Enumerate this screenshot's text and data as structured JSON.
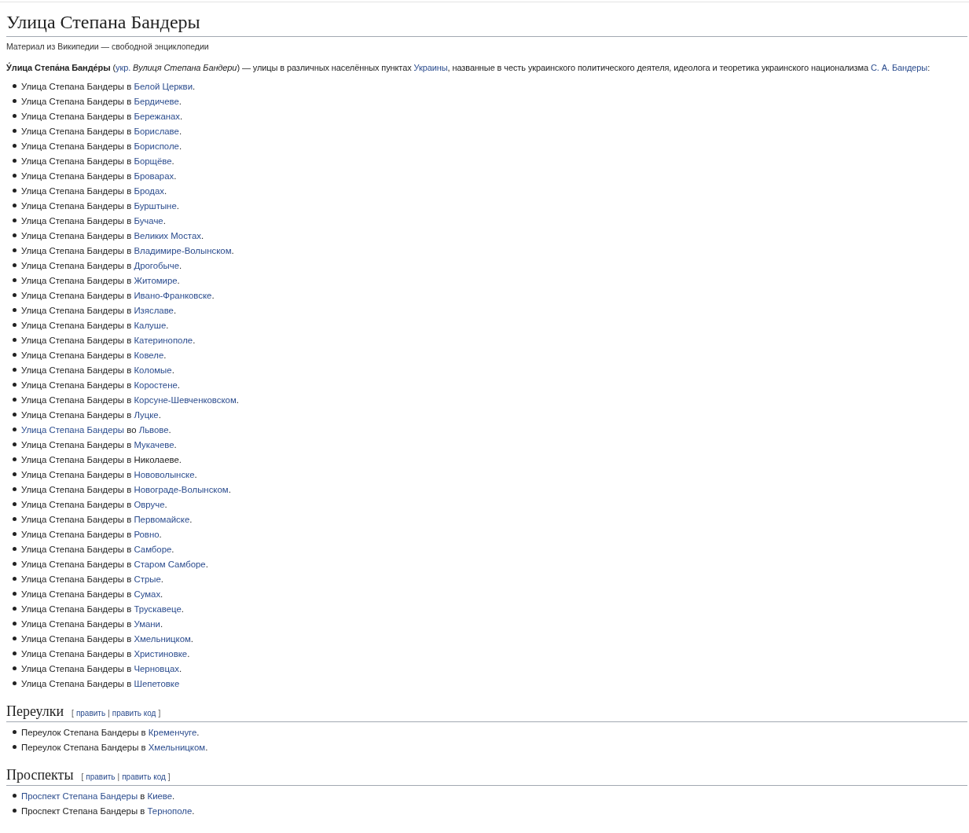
{
  "title": "Улица Степана Бандеры",
  "subtitle": "Материал из Википедии — свободной энциклопедии",
  "intro": [
    {
      "kind": "bold",
      "text": "У́лица Степа́на Банде́ры"
    },
    {
      "kind": "text",
      "text": " ("
    },
    {
      "kind": "link",
      "text": "укр."
    },
    {
      "kind": "italic",
      "text": " Вулиця Степана Бандери"
    },
    {
      "kind": "text",
      "text": ") — улицы в различных населённых пунктах "
    },
    {
      "kind": "link",
      "text": "Украины"
    },
    {
      "kind": "text",
      "text": ", названные в честь украинского политического деятеля, идеолога и теоретика украинского национализма "
    },
    {
      "kind": "link",
      "text": "С. А. Бандеры"
    },
    {
      "kind": "text",
      "text": ":"
    }
  ],
  "items": [
    {
      "parts": [
        {
          "kind": "text",
          "text": "Улица Степана Бандеры в "
        },
        {
          "kind": "link",
          "text": "Белой Церкви"
        },
        {
          "kind": "text",
          "text": "."
        }
      ]
    },
    {
      "parts": [
        {
          "kind": "text",
          "text": "Улица Степана Бандеры в "
        },
        {
          "kind": "link",
          "text": "Бердичеве"
        },
        {
          "kind": "text",
          "text": "."
        }
      ]
    },
    {
      "parts": [
        {
          "kind": "text",
          "text": "Улица Степана Бандеры в "
        },
        {
          "kind": "link",
          "text": "Бережанах"
        },
        {
          "kind": "text",
          "text": "."
        }
      ]
    },
    {
      "parts": [
        {
          "kind": "text",
          "text": "Улица Степана Бандеры в "
        },
        {
          "kind": "link",
          "text": "Бориславе"
        },
        {
          "kind": "text",
          "text": "."
        }
      ]
    },
    {
      "parts": [
        {
          "kind": "text",
          "text": "Улица Степана Бандеры в "
        },
        {
          "kind": "link",
          "text": "Борисполе"
        },
        {
          "kind": "text",
          "text": "."
        }
      ]
    },
    {
      "parts": [
        {
          "kind": "text",
          "text": "Улица Степана Бандеры в "
        },
        {
          "kind": "link",
          "text": "Борщёве"
        },
        {
          "kind": "text",
          "text": "."
        }
      ]
    },
    {
      "parts": [
        {
          "kind": "text",
          "text": "Улица Степана Бандеры в "
        },
        {
          "kind": "link",
          "text": "Броварах"
        },
        {
          "kind": "text",
          "text": "."
        }
      ]
    },
    {
      "parts": [
        {
          "kind": "text",
          "text": "Улица Степана Бандеры в "
        },
        {
          "kind": "link",
          "text": "Бродах"
        },
        {
          "kind": "text",
          "text": "."
        }
      ]
    },
    {
      "parts": [
        {
          "kind": "text",
          "text": "Улица Степана Бандеры в "
        },
        {
          "kind": "link",
          "text": "Бурштыне"
        },
        {
          "kind": "text",
          "text": "."
        }
      ]
    },
    {
      "parts": [
        {
          "kind": "text",
          "text": "Улица Степана Бандеры в "
        },
        {
          "kind": "link",
          "text": "Бучаче"
        },
        {
          "kind": "text",
          "text": "."
        }
      ]
    },
    {
      "parts": [
        {
          "kind": "text",
          "text": "Улица Степана Бандеры в "
        },
        {
          "kind": "link",
          "text": "Великих Мостах"
        },
        {
          "kind": "text",
          "text": "."
        }
      ]
    },
    {
      "parts": [
        {
          "kind": "text",
          "text": "Улица Степана Бандеры в "
        },
        {
          "kind": "link",
          "text": "Владимире-Волынском"
        },
        {
          "kind": "text",
          "text": "."
        }
      ]
    },
    {
      "parts": [
        {
          "kind": "text",
          "text": "Улица Степана Бандеры в "
        },
        {
          "kind": "link",
          "text": "Дрогобыче"
        },
        {
          "kind": "text",
          "text": "."
        }
      ]
    },
    {
      "parts": [
        {
          "kind": "text",
          "text": "Улица Степана Бандеры в "
        },
        {
          "kind": "link",
          "text": "Житомире"
        },
        {
          "kind": "text",
          "text": "."
        }
      ]
    },
    {
      "parts": [
        {
          "kind": "text",
          "text": "Улица Степана Бандеры в "
        },
        {
          "kind": "link",
          "text": "Ивано-Франковске"
        },
        {
          "kind": "text",
          "text": "."
        }
      ]
    },
    {
      "parts": [
        {
          "kind": "text",
          "text": "Улица Степана Бандеры в "
        },
        {
          "kind": "link",
          "text": "Изяславе"
        },
        {
          "kind": "text",
          "text": "."
        }
      ]
    },
    {
      "parts": [
        {
          "kind": "text",
          "text": "Улица Степана Бандеры в "
        },
        {
          "kind": "link",
          "text": "Калуше"
        },
        {
          "kind": "text",
          "text": "."
        }
      ]
    },
    {
      "parts": [
        {
          "kind": "text",
          "text": "Улица Степана Бандеры в "
        },
        {
          "kind": "link",
          "text": "Катеринополе"
        },
        {
          "kind": "text",
          "text": "."
        }
      ]
    },
    {
      "parts": [
        {
          "kind": "text",
          "text": "Улица Степана Бандеры в "
        },
        {
          "kind": "link",
          "text": "Ковеле"
        },
        {
          "kind": "text",
          "text": "."
        }
      ]
    },
    {
      "parts": [
        {
          "kind": "text",
          "text": "Улица Степана Бандеры в "
        },
        {
          "kind": "link",
          "text": "Коломые"
        },
        {
          "kind": "text",
          "text": "."
        }
      ]
    },
    {
      "parts": [
        {
          "kind": "text",
          "text": "Улица Степана Бандеры в "
        },
        {
          "kind": "link",
          "text": "Коростене"
        },
        {
          "kind": "text",
          "text": "."
        }
      ]
    },
    {
      "parts": [
        {
          "kind": "text",
          "text": "Улица Степана Бандеры в "
        },
        {
          "kind": "link",
          "text": "Корсуне-Шевченковском"
        },
        {
          "kind": "text",
          "text": "."
        }
      ]
    },
    {
      "parts": [
        {
          "kind": "text",
          "text": "Улица Степана Бандеры в "
        },
        {
          "kind": "link",
          "text": "Луцке"
        },
        {
          "kind": "text",
          "text": "."
        }
      ]
    },
    {
      "parts": [
        {
          "kind": "link",
          "text": "Улица Степана Бандеры"
        },
        {
          "kind": "text",
          "text": " во "
        },
        {
          "kind": "link",
          "text": "Львове"
        },
        {
          "kind": "text",
          "text": "."
        }
      ]
    },
    {
      "parts": [
        {
          "kind": "text",
          "text": "Улица Степана Бандеры в "
        },
        {
          "kind": "link",
          "text": "Мукачеве"
        },
        {
          "kind": "text",
          "text": "."
        }
      ]
    },
    {
      "parts": [
        {
          "kind": "text",
          "text": "Улица Степана Бандеры в Николаеве."
        }
      ]
    },
    {
      "parts": [
        {
          "kind": "text",
          "text": "Улица Степана Бандеры в "
        },
        {
          "kind": "link",
          "text": "Нововолынске"
        },
        {
          "kind": "text",
          "text": "."
        }
      ]
    },
    {
      "parts": [
        {
          "kind": "text",
          "text": "Улица Степана Бандеры в "
        },
        {
          "kind": "link",
          "text": "Новограде-Волынском"
        },
        {
          "kind": "text",
          "text": "."
        }
      ]
    },
    {
      "parts": [
        {
          "kind": "text",
          "text": "Улица Степана Бандеры в "
        },
        {
          "kind": "link",
          "text": "Овруче"
        },
        {
          "kind": "text",
          "text": "."
        }
      ]
    },
    {
      "parts": [
        {
          "kind": "text",
          "text": "Улица Степана Бандеры в "
        },
        {
          "kind": "link",
          "text": "Первомайске"
        },
        {
          "kind": "text",
          "text": "."
        }
      ]
    },
    {
      "parts": [
        {
          "kind": "text",
          "text": "Улица Степана Бандеры в "
        },
        {
          "kind": "link",
          "text": "Ровно"
        },
        {
          "kind": "text",
          "text": "."
        }
      ]
    },
    {
      "parts": [
        {
          "kind": "text",
          "text": "Улица Степана Бандеры в "
        },
        {
          "kind": "link",
          "text": "Самборе"
        },
        {
          "kind": "text",
          "text": "."
        }
      ]
    },
    {
      "parts": [
        {
          "kind": "text",
          "text": "Улица Степана Бандеры в "
        },
        {
          "kind": "link",
          "text": "Старом Самборе"
        },
        {
          "kind": "text",
          "text": "."
        }
      ]
    },
    {
      "parts": [
        {
          "kind": "text",
          "text": "Улица Степана Бандеры в "
        },
        {
          "kind": "link",
          "text": "Стрые"
        },
        {
          "kind": "text",
          "text": "."
        }
      ]
    },
    {
      "parts": [
        {
          "kind": "text",
          "text": "Улица Степана Бандеры в "
        },
        {
          "kind": "link",
          "text": "Сумах"
        },
        {
          "kind": "text",
          "text": "."
        }
      ]
    },
    {
      "parts": [
        {
          "kind": "text",
          "text": "Улица Степана Бандеры в "
        },
        {
          "kind": "link",
          "text": "Трускавеце"
        },
        {
          "kind": "text",
          "text": "."
        }
      ]
    },
    {
      "parts": [
        {
          "kind": "text",
          "text": "Улица Степана Бандеры в "
        },
        {
          "kind": "link",
          "text": "Умани"
        },
        {
          "kind": "text",
          "text": "."
        }
      ]
    },
    {
      "parts": [
        {
          "kind": "text",
          "text": "Улица Степана Бандеры в "
        },
        {
          "kind": "link",
          "text": "Хмельницком"
        },
        {
          "kind": "text",
          "text": "."
        }
      ]
    },
    {
      "parts": [
        {
          "kind": "text",
          "text": "Улица Степана Бандеры в "
        },
        {
          "kind": "link",
          "text": "Христиновке"
        },
        {
          "kind": "text",
          "text": "."
        }
      ]
    },
    {
      "parts": [
        {
          "kind": "text",
          "text": "Улица Степана Бандеры в "
        },
        {
          "kind": "link",
          "text": "Черновцах"
        },
        {
          "kind": "text",
          "text": "."
        }
      ]
    },
    {
      "parts": [
        {
          "kind": "text",
          "text": "Улица Степана Бандеры в "
        },
        {
          "kind": "link",
          "text": "Шепетовке"
        }
      ]
    }
  ],
  "sections": [
    {
      "title": "Переулки",
      "edit": [
        {
          "kind": "text",
          "text": "["
        },
        {
          "kind": "link",
          "text": "править"
        },
        {
          "kind": "text",
          "text": "|"
        },
        {
          "kind": "link",
          "text": "править код"
        },
        {
          "kind": "text",
          "text": "]"
        }
      ],
      "items": [
        {
          "parts": [
            {
              "kind": "text",
              "text": "Переулок Степана Бандеры в "
            },
            {
              "kind": "link",
              "text": "Кременчуге"
            },
            {
              "kind": "text",
              "text": "."
            }
          ]
        },
        {
          "parts": [
            {
              "kind": "text",
              "text": "Переулок Степана Бандеры в "
            },
            {
              "kind": "link",
              "text": "Хмельницком"
            },
            {
              "kind": "text",
              "text": "."
            }
          ]
        }
      ]
    },
    {
      "title": "Проспекты",
      "edit": [
        {
          "kind": "text",
          "text": "["
        },
        {
          "kind": "link",
          "text": "править"
        },
        {
          "kind": "text",
          "text": "|"
        },
        {
          "kind": "link",
          "text": "править код"
        },
        {
          "kind": "text",
          "text": "]"
        }
      ],
      "items": [
        {
          "parts": [
            {
              "kind": "link",
              "text": "Проспект Степана Бандеры"
            },
            {
              "kind": "text",
              "text": " в "
            },
            {
              "kind": "link",
              "text": "Киеве"
            },
            {
              "kind": "text",
              "text": "."
            }
          ]
        },
        {
          "parts": [
            {
              "kind": "text",
              "text": "Проспект Степана Бандеры в "
            },
            {
              "kind": "link",
              "text": "Тернополе"
            },
            {
              "kind": "text",
              "text": "."
            }
          ]
        }
      ]
    }
  ]
}
